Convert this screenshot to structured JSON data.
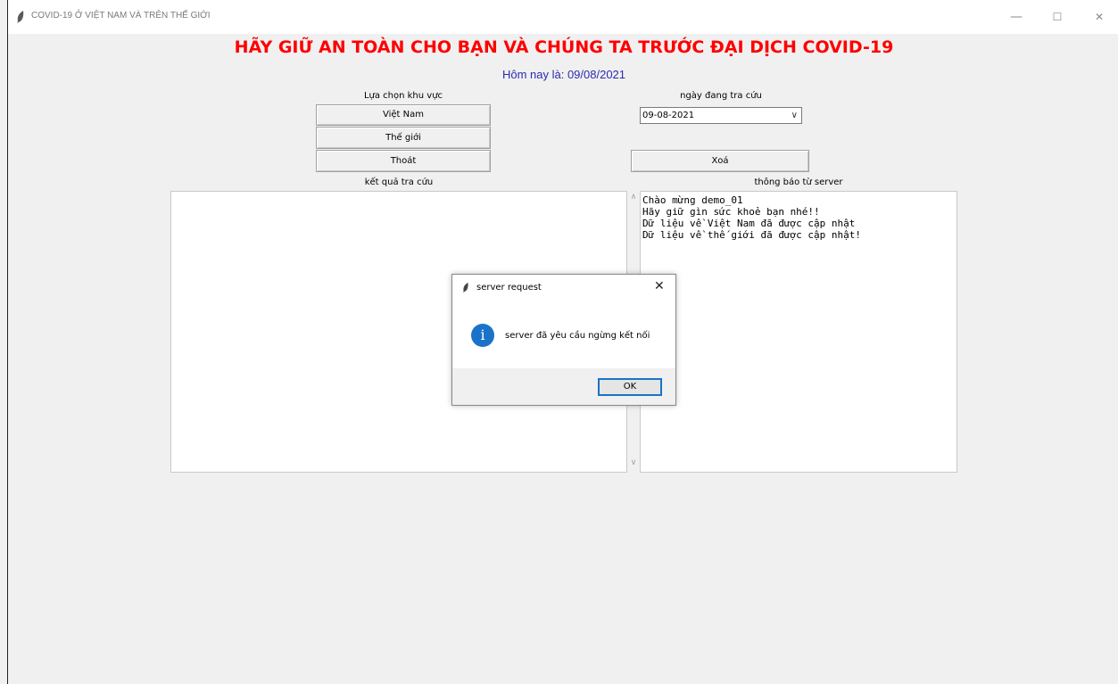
{
  "window": {
    "title": "COVID-19 Ở VIỆT NAM VÀ TRÊN THẾ GIỚI",
    "minimize": "—",
    "maximize": "☐",
    "close": "✕"
  },
  "header": {
    "headline": "HÃY GIỮ AN TOÀN CHO BẠN VÀ CHÚNG TA TRƯỚC ĐẠI DỊCH COVID-19",
    "today": "Hôm nay là: 09/08/2021"
  },
  "region": {
    "label": "Lựa chọn khu vực",
    "vietnam_button": "Việt Nam",
    "world_button": "Thế giới",
    "exit_button": "Thoát"
  },
  "date": {
    "label": "ngày đang tra cứu",
    "selected": "09-08-2021",
    "chevron": "∨"
  },
  "clear_button": "Xoá",
  "results": {
    "label": "kết quả tra cứu"
  },
  "server": {
    "label": "thông báo từ server",
    "messages": [
      "Chào mừng demo_01",
      "Hãy giữ gìn sức khoẻ bạn nhé!!",
      "Dữ liệu về Việt Nam đã được cập nhật",
      "Dữ liệu về thế giới đã được cập nhật!"
    ]
  },
  "dialog": {
    "title": "server request",
    "close": "✕",
    "icon_glyph": "i",
    "message": "server đã yêu cầu ngừng kết nối",
    "ok_label": "OK"
  },
  "colors": {
    "headline": "#ff0000",
    "today": "#2b2bb0",
    "info_icon": "#1a73c8"
  }
}
